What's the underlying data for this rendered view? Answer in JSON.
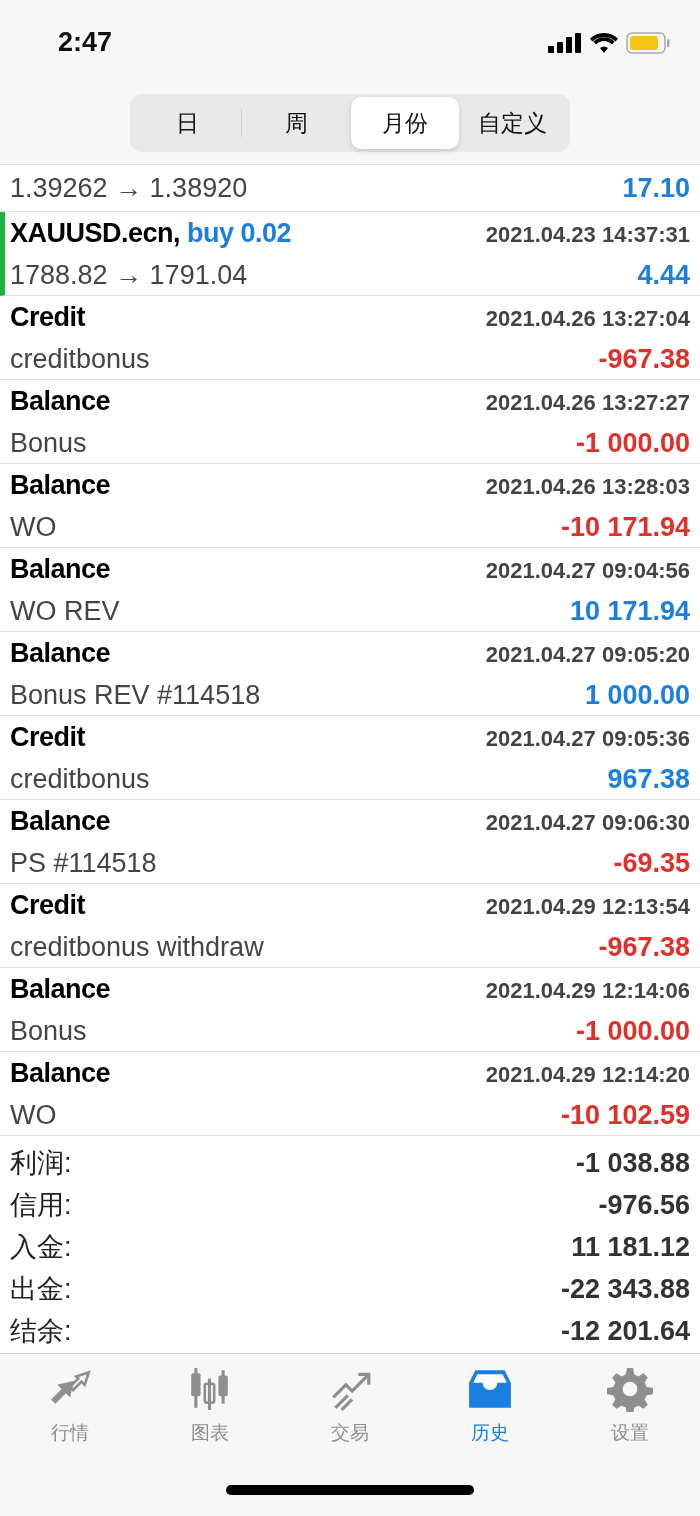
{
  "status_bar": {
    "time": "2:47"
  },
  "period_tabs": [
    {
      "label": "日",
      "selected": false
    },
    {
      "label": "周",
      "selected": false
    },
    {
      "label": "月份",
      "selected": true
    },
    {
      "label": "自定义",
      "selected": false
    }
  ],
  "rows": [
    {
      "kind": "partial",
      "detail": "1.39262 → 1.38920",
      "amount": "17.10",
      "color": "#1a7fe0"
    },
    {
      "kind": "trade",
      "title": "XAUUSD.ecn,",
      "action": "buy 0.02",
      "time": "2021.04.23 14:37:31",
      "detail": "1788.82 → 1791.04",
      "amount": "4.44",
      "color": "#1a7fe0"
    },
    {
      "kind": "entry",
      "title": "Credit",
      "time": "2021.04.26 13:27:04",
      "detail": "creditbonus",
      "amount": "-967.38",
      "color": "#e0302a"
    },
    {
      "kind": "entry",
      "title": "Balance",
      "time": "2021.04.26 13:27:27",
      "detail": "Bonus",
      "amount": "-1 000.00",
      "color": "#e0302a"
    },
    {
      "kind": "entry",
      "title": "Balance",
      "time": "2021.04.26 13:28:03",
      "detail": "WO",
      "amount": "-10 171.94",
      "color": "#e0302a"
    },
    {
      "kind": "entry",
      "title": "Balance",
      "time": "2021.04.27 09:04:56",
      "detail": "WO REV",
      "amount": "10 171.94",
      "color": "#1a7fe0"
    },
    {
      "kind": "entry",
      "title": "Balance",
      "time": "2021.04.27 09:05:20",
      "detail": "Bonus REV #114518",
      "amount": "1 000.00",
      "color": "#1a7fe0"
    },
    {
      "kind": "entry",
      "title": "Credit",
      "time": "2021.04.27 09:05:36",
      "detail": "creditbonus",
      "amount": "967.38",
      "color": "#1a7fe0"
    },
    {
      "kind": "entry",
      "title": "Balance",
      "time": "2021.04.27 09:06:30",
      "detail": "PS #114518",
      "amount": "-69.35",
      "color": "#e0302a"
    },
    {
      "kind": "entry",
      "title": "Credit",
      "time": "2021.04.29 12:13:54",
      "detail": "creditbonus withdraw",
      "amount": "-967.38",
      "color": "#e0302a"
    },
    {
      "kind": "entry",
      "title": "Balance",
      "time": "2021.04.29 12:14:06",
      "detail": "Bonus",
      "amount": "-1 000.00",
      "color": "#e0302a"
    },
    {
      "kind": "entry",
      "title": "Balance",
      "time": "2021.04.29 12:14:20",
      "detail": "WO",
      "amount": "-10 102.59",
      "color": "#e0302a"
    }
  ],
  "summary": [
    {
      "label": "利润:",
      "value": "-1 038.88"
    },
    {
      "label": "信用:",
      "value": "-976.56"
    },
    {
      "label": "入金:",
      "value": "11 181.12"
    },
    {
      "label": "出金:",
      "value": "-22 343.88"
    },
    {
      "label": "结余:",
      "value": "-12 201.64"
    }
  ],
  "tab_bar": [
    {
      "kind": "quotes",
      "label": "行情",
      "selected": false
    },
    {
      "kind": "chart",
      "label": "图表",
      "selected": false
    },
    {
      "kind": "trade",
      "label": "交易",
      "selected": false
    },
    {
      "kind": "history",
      "label": "历史",
      "selected": true
    },
    {
      "kind": "settings",
      "label": "设置",
      "selected": false
    }
  ]
}
